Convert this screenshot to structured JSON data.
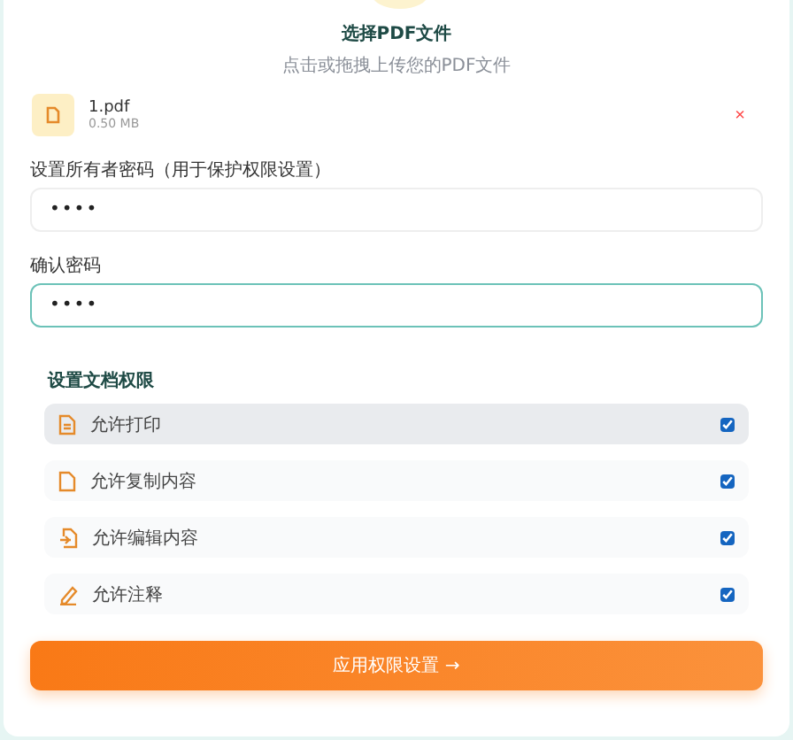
{
  "upload": {
    "title": "选择PDF文件",
    "subtitle": "点击或拖拽上传您的PDF文件"
  },
  "file": {
    "name": "1.pdf",
    "size": "0.50 MB",
    "remove": "×"
  },
  "fields": [
    {
      "label": "设置所有者密码（用于保护权限设置）",
      "value": "••••",
      "focused": false
    },
    {
      "label": "确认密码",
      "value": "••••",
      "focused": true
    }
  ],
  "permissions": {
    "title": "设置文档权限",
    "items": [
      {
        "kind": "print",
        "label": "允许打印",
        "checked": true,
        "highlighted": true
      },
      {
        "kind": "copy",
        "label": "允许复制内容",
        "checked": true,
        "highlighted": false
      },
      {
        "kind": "edit",
        "label": "允许编辑内容",
        "checked": true,
        "highlighted": false
      },
      {
        "kind": "annotate",
        "label": "允许注释",
        "checked": true,
        "highlighted": false
      }
    ]
  },
  "submit": {
    "label": "应用权限设置",
    "arrow": "→"
  }
}
